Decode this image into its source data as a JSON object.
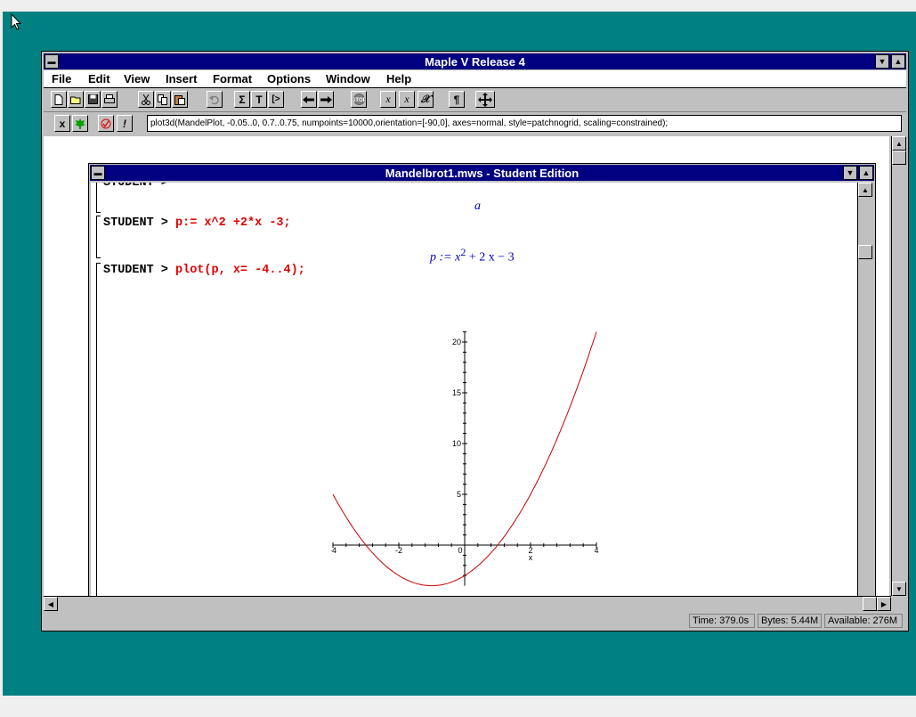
{
  "app": {
    "title": "Maple V Release 4",
    "menu": [
      "File",
      "Edit",
      "View",
      "Insert",
      "Format",
      "Options",
      "Window",
      "Help"
    ],
    "command_text": "plot3d(MandelPlot, -0.05..0, 0.7..0.75, numpoints=10000,orientation=[-90,0], axes=normal, style=patchnogrid, scaling=constrained);",
    "toolbar_symbols": {
      "sigma": "Σ",
      "text": "T",
      "exec": "[>",
      "para": "¶",
      "x1": "x",
      "x2": "x",
      "x3": "𝒳",
      "ctx_x": "x",
      "ctx_bang": "!"
    }
  },
  "status": {
    "time": "Time: 379.0s",
    "bytes": "Bytes: 5.44M",
    "available": "Available: 276M"
  },
  "document": {
    "title": "Mandelbrot1.mws - Student Edition",
    "top_partial": "STUDENT >",
    "output_a": "a",
    "line1_prompt": "STUDENT > ",
    "line1_code": "p:= x^2 +2*x -3;",
    "output_p": "p := x",
    "output_p_exp": "2",
    "output_p_rest": " + 2 x − 3",
    "line2_prompt": "STUDENT > ",
    "line2_code": "plot(p, x= -4..4);"
  },
  "chart_data": {
    "type": "line",
    "function": "x^2+2*x-3",
    "xlim": [
      -4,
      4
    ],
    "ylim": [
      -4,
      21
    ],
    "xlabel": "x",
    "ylabel": "",
    "x_ticks": [
      "-4",
      "-2",
      "0",
      "2",
      "4"
    ],
    "y_ticks": [
      "5",
      "10",
      "15",
      "20"
    ],
    "color": "#cc0000",
    "series": [
      {
        "x": [
          -4,
          -3.5,
          -3,
          -2.5,
          -2,
          -1.5,
          -1,
          -0.5,
          0,
          0.5,
          1,
          1.5,
          2,
          2.5,
          3,
          3.5,
          4
        ],
        "y": [
          5,
          2.25,
          0,
          -1.75,
          -3,
          -3.75,
          -4,
          -3.75,
          -3,
          -1.75,
          0,
          2.25,
          5,
          8.25,
          12,
          16.25,
          21
        ]
      }
    ]
  }
}
